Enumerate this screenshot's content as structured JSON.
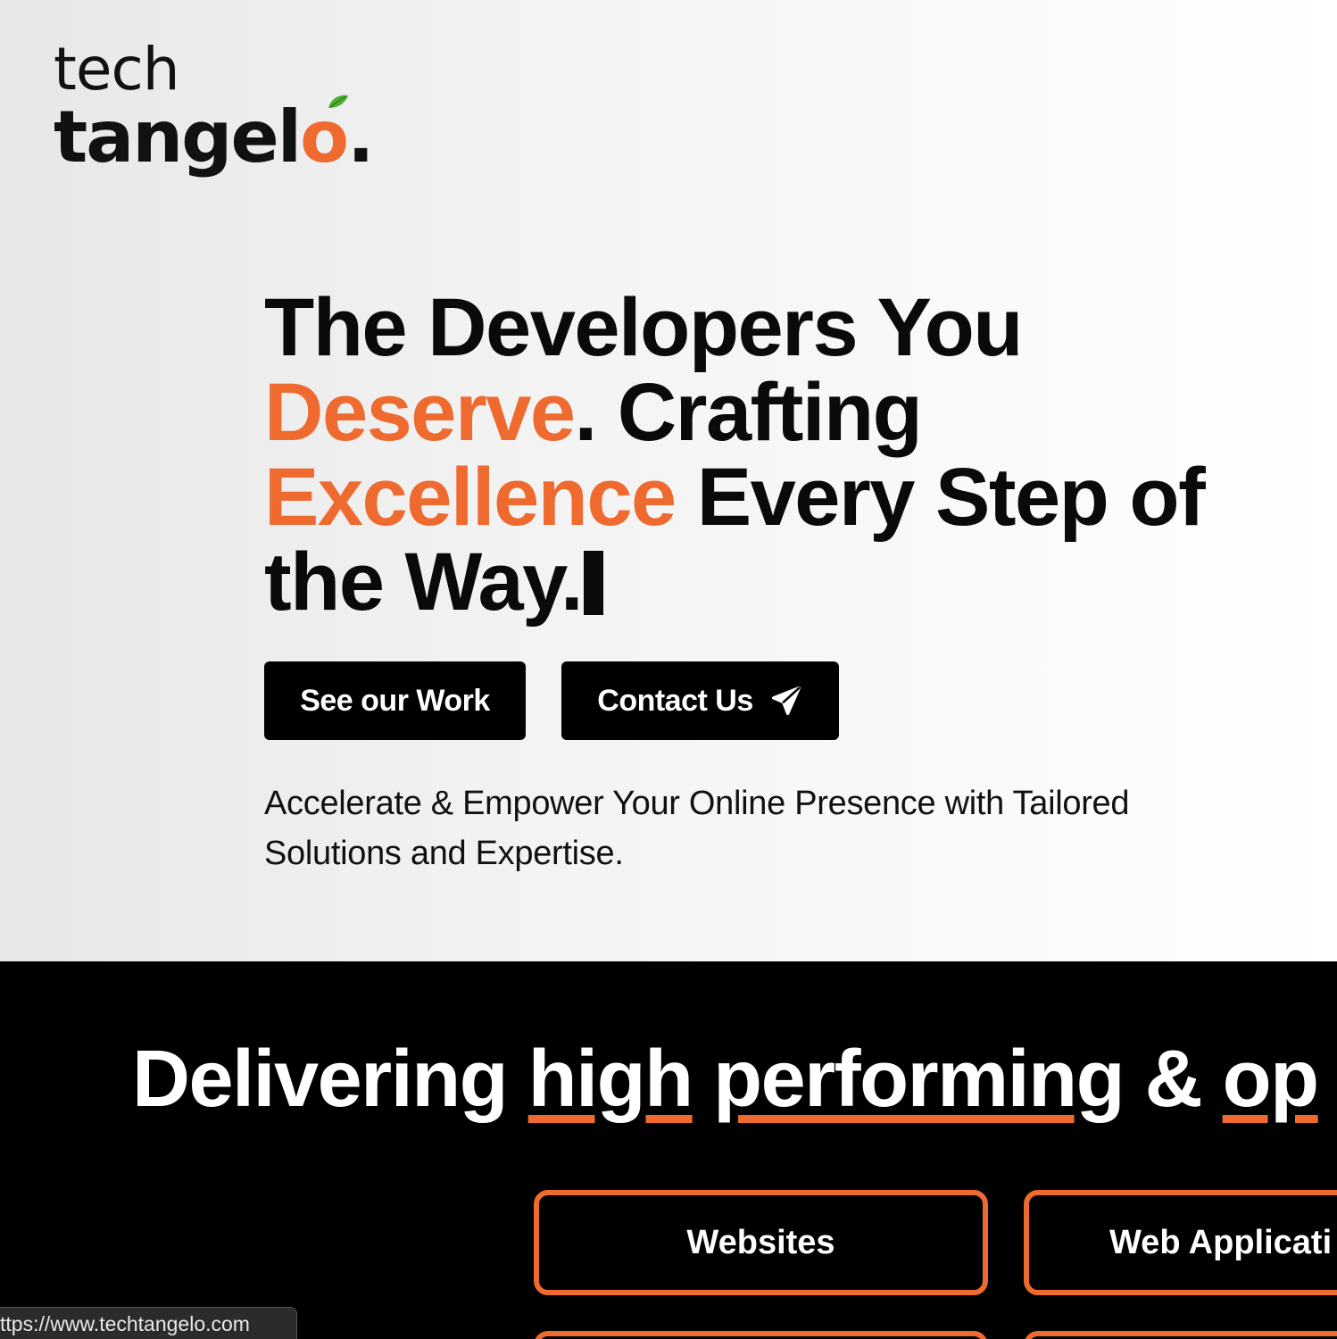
{
  "logo": {
    "line1": "tech",
    "line2_main": "tangel",
    "line2_accent": "o",
    "line2_dot": ".",
    "leaf_icon": "leaf-icon"
  },
  "hero": {
    "headline": {
      "part1": "The Developers You ",
      "highlight1": "Deserve",
      "part2": ". Crafting ",
      "highlight2": "Excellence",
      "part3": " Every Step of the Way."
    },
    "buttons": {
      "see_work": "See our Work",
      "contact": "Contact Us",
      "contact_icon": "paper-plane-icon"
    },
    "subtext": "Accelerate & Empower Your Online Presence with Tailored Solutions and Expertise."
  },
  "services": {
    "tagline": {
      "word1": "Delivering",
      "word2": "high",
      "word3": "performing",
      "word4": "&",
      "word5": "op"
    },
    "cards": [
      "Websites",
      "Web Applicati"
    ]
  },
  "status_bar": {
    "url": "ttps://www.techtangelo.com"
  },
  "colors": {
    "accent": "#ee6a2f",
    "text": "#0a0a0a",
    "dark_bg": "#000000"
  }
}
